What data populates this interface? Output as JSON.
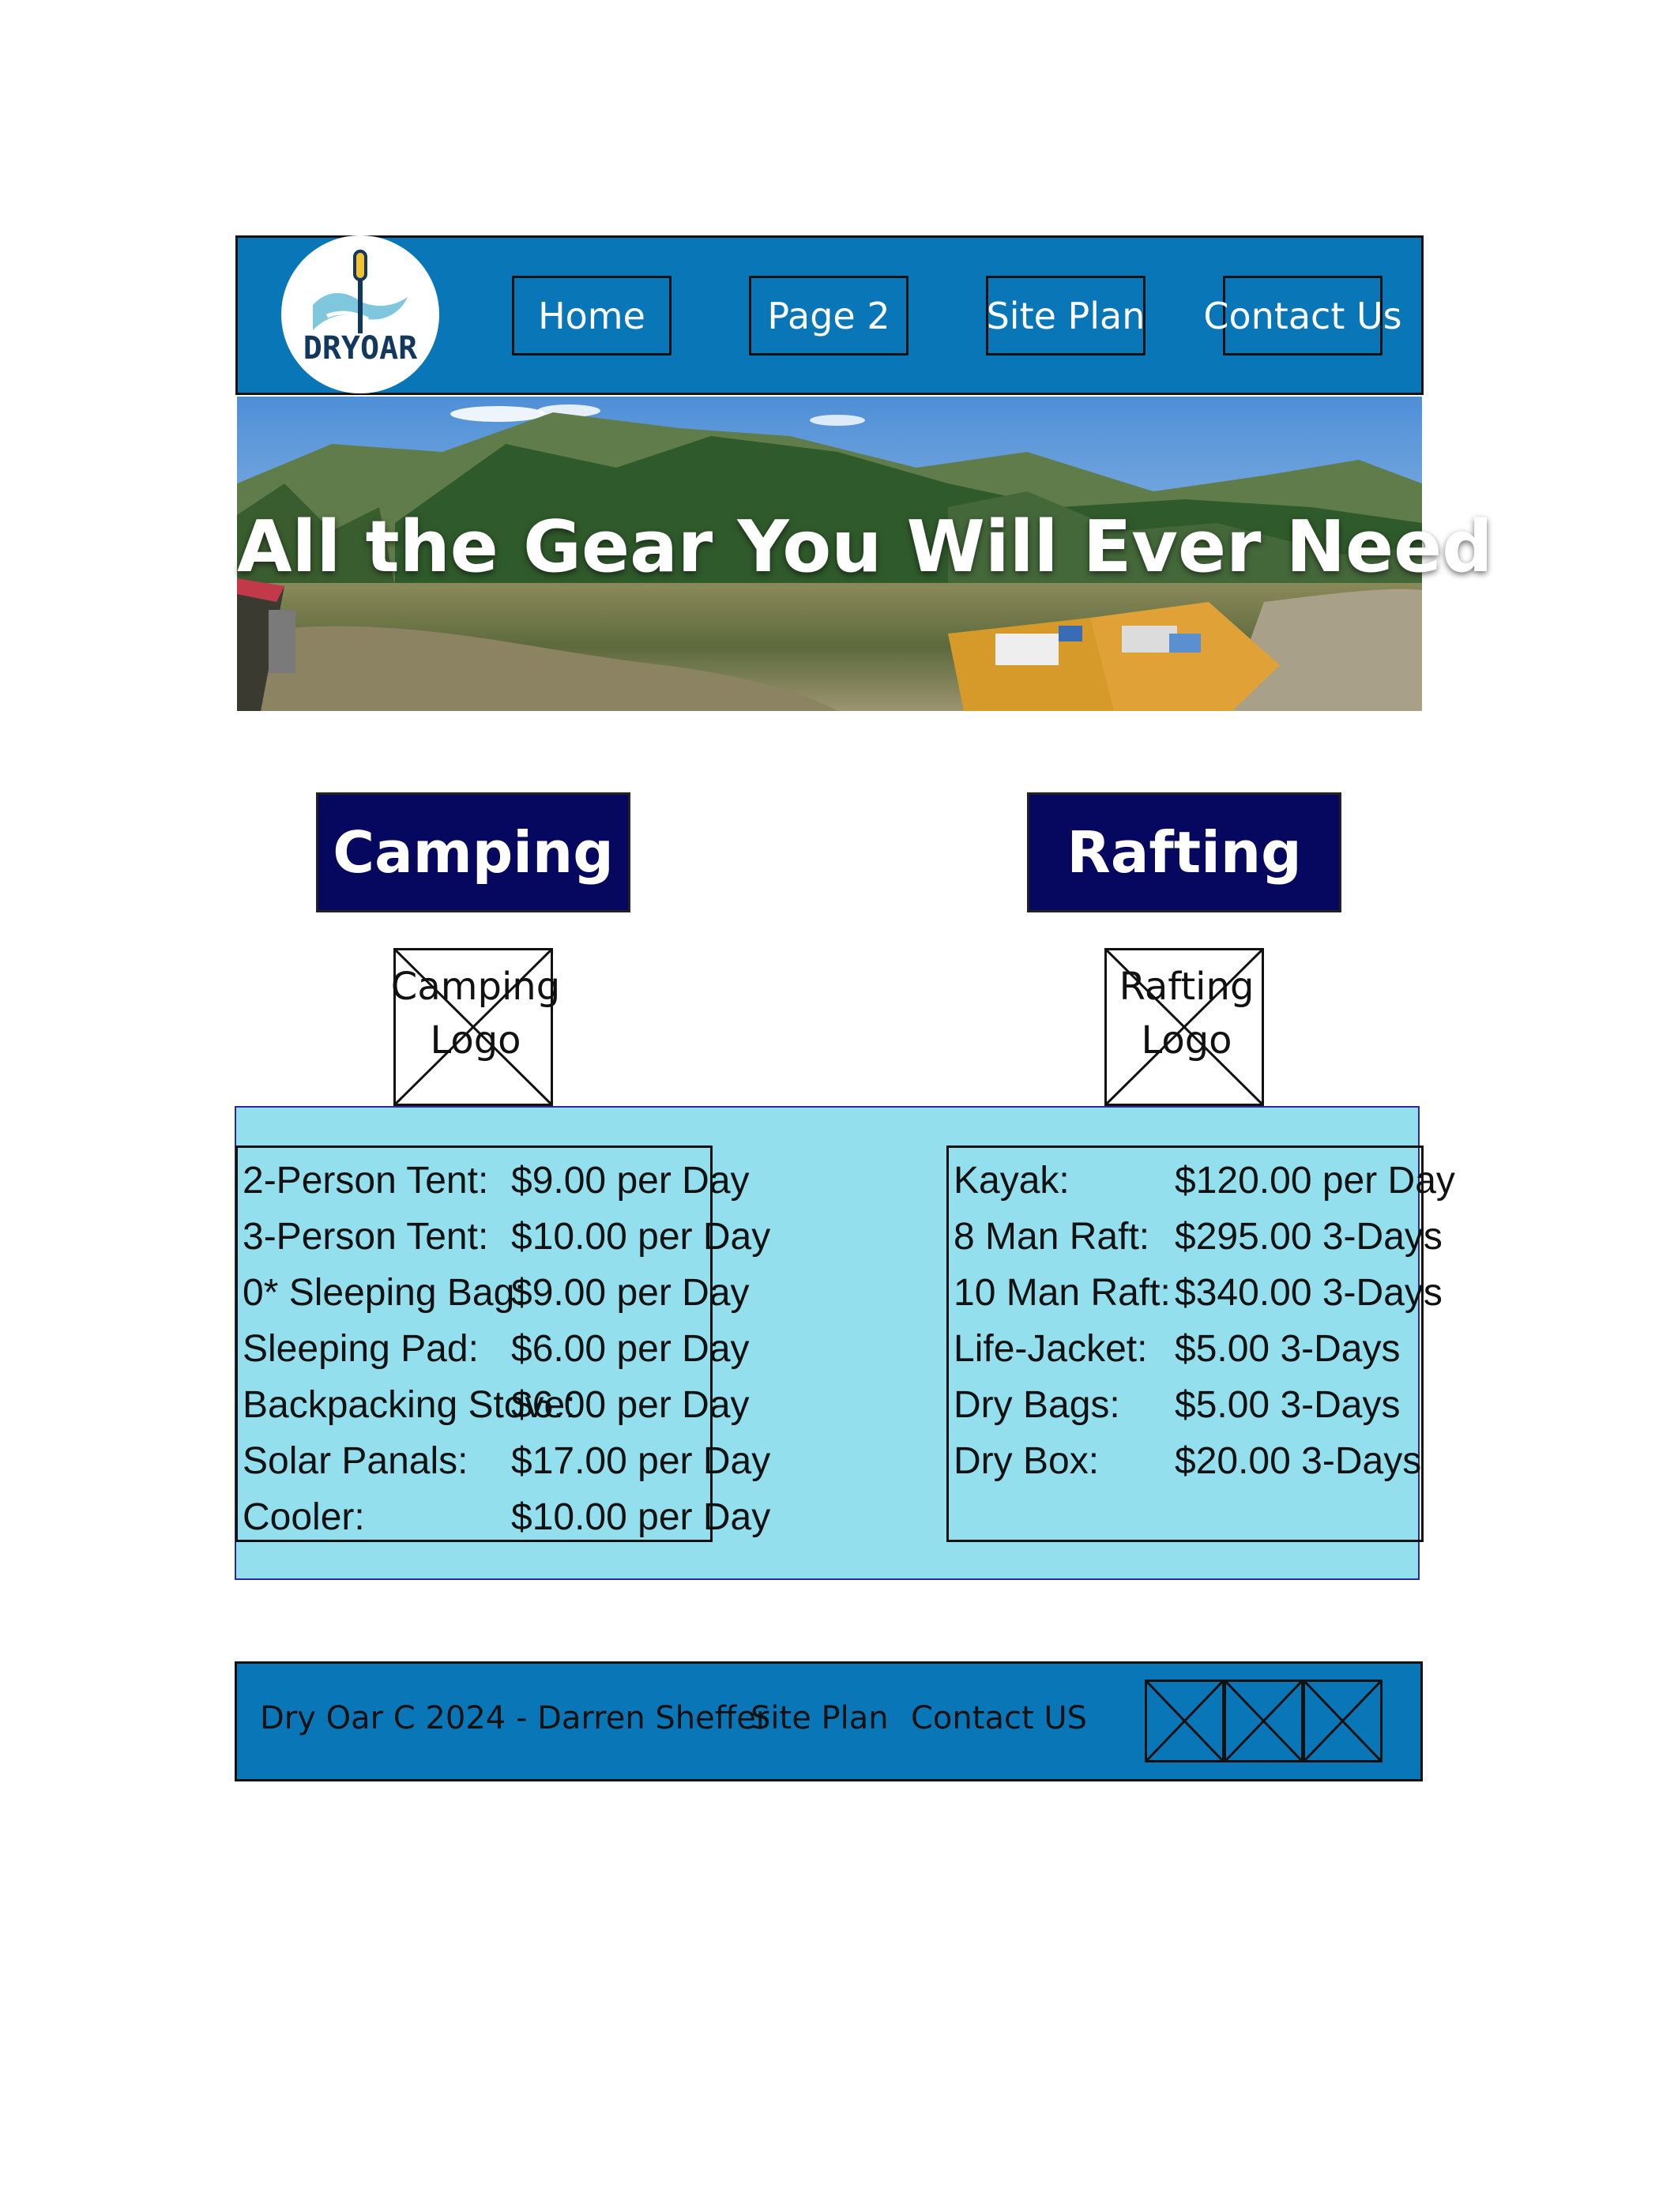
{
  "brand": {
    "logo_text": "DRYOAR"
  },
  "nav": {
    "items": [
      {
        "label": "Home"
      },
      {
        "label": "Page 2"
      },
      {
        "label": "Site Plan"
      },
      {
        "label": "Contact Us"
      }
    ]
  },
  "hero": {
    "title": "All the Gear You Will Ever Need"
  },
  "sections": {
    "camping": {
      "heading": "Camping",
      "logo_placeholder": "Camping Logo",
      "items": [
        {
          "name": "2-Person Tent:",
          "price": "$9.00 per Day"
        },
        {
          "name": "3-Person Tent:",
          "price": "$10.00 per Day"
        },
        {
          "name": "0* Sleeping Bag:",
          "price": "$9.00 per Day"
        },
        {
          "name": "Sleeping Pad:",
          "price": "$6.00 per Day"
        },
        {
          "name": "Backpacking Stove:",
          "price": "$6.00 per Day"
        },
        {
          "name": "Solar Panals:",
          "price": "$17.00 per Day"
        },
        {
          "name": "Cooler:",
          "price": "$10.00 per Day"
        }
      ]
    },
    "rafting": {
      "heading": "Rafting",
      "logo_placeholder": "Rafting Logo",
      "items": [
        {
          "name": "Kayak:",
          "price": "$120.00 per Day"
        },
        {
          "name": "8 Man Raft:",
          "price": "$295.00 3-Days"
        },
        {
          "name": "10 Man Raft:",
          "price": "$340.00 3-Days"
        },
        {
          "name": "Life-Jacket:",
          "price": "$5.00 3-Days"
        },
        {
          "name": "Dry Bags:",
          "price": "$5.00 3-Days"
        },
        {
          "name": "Dry Box:",
          "price": "$20.00 3-Days"
        }
      ]
    }
  },
  "footer": {
    "copyright": "Dry Oar C 2024 - Darren Sheffer",
    "site_plan": "Site Plan",
    "contact": "Contact US",
    "social_count": 3
  },
  "colors": {
    "header_blue": "#0976b8",
    "heading_navy": "#06075e",
    "panel_cyan": "#94dfee"
  }
}
